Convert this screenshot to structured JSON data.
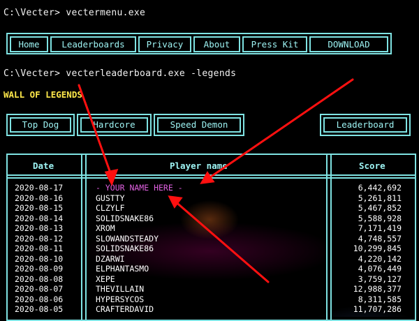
{
  "cmd1": "C:\\Vecter> vectermenu.exe",
  "nav": [
    "Home",
    "Leaderboards",
    "Privacy",
    "About",
    "Press Kit",
    "DOWNLOAD"
  ],
  "cmd2": "C:\\Vecter> vecterleaderboard.exe -legends",
  "wall_title": "WALL OF LEGENDS",
  "filters": [
    "Top Dog",
    "Hardcore",
    "Speed Demon"
  ],
  "leaderboard_button": "Leaderboard",
  "table": {
    "headers": [
      "Date",
      "Player name",
      "Score"
    ],
    "rows": [
      {
        "date": "2020-08-17",
        "player": "- YOUR NAME HERE -",
        "score": "6,442,692"
      },
      {
        "date": "2020-08-16",
        "player": "GUSTTY",
        "score": "5,261,811"
      },
      {
        "date": "2020-08-15",
        "player": "CLZYLF",
        "score": "5,467,852"
      },
      {
        "date": "2020-08-14",
        "player": "SOLIDSNAKE86",
        "score": "5,588,928"
      },
      {
        "date": "2020-08-13",
        "player": "XROM",
        "score": "7,171,419"
      },
      {
        "date": "2020-08-12",
        "player": "SLOWANDSTEADY",
        "score": "4,748,557"
      },
      {
        "date": "2020-08-11",
        "player": "SOLIDSNAKE86",
        "score": "10,299,845"
      },
      {
        "date": "2020-08-10",
        "player": "DZARWI",
        "score": "4,220,142"
      },
      {
        "date": "2020-08-09",
        "player": "ELPHANTASMO",
        "score": "4,076,449"
      },
      {
        "date": "2020-08-08",
        "player": "XEPE",
        "score": "3,759,127"
      },
      {
        "date": "2020-08-07",
        "player": "THEVILLAIN",
        "score": "12,988,377"
      },
      {
        "date": "2020-08-06",
        "player": "HYPERSYCOS",
        "score": "8,311,585"
      },
      {
        "date": "2020-08-05",
        "player": "CRAFTERDAVID",
        "score": "11,707,286"
      }
    ]
  },
  "colors": {
    "accent": "#7fe3e3",
    "title": "#ffe84a",
    "highlight": "#e060e0",
    "annotation": "#ff1010"
  }
}
